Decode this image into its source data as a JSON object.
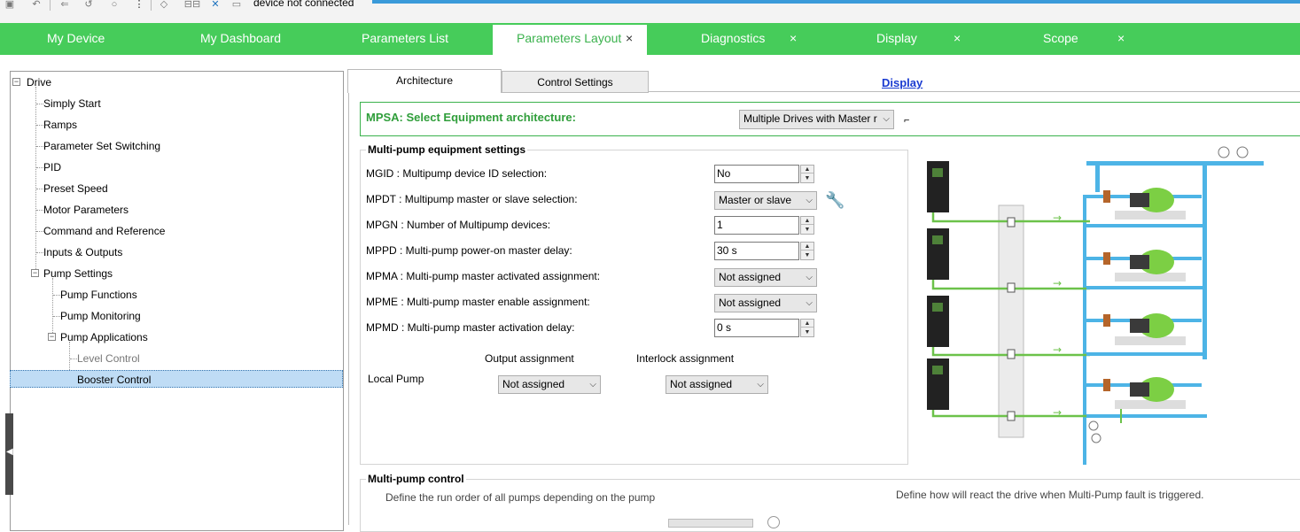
{
  "toolbar": {
    "connection_status": "device not connected",
    "icons": [
      "device-icon",
      "back-icon",
      "forward-icon",
      "undo-icon",
      "refresh-icon",
      "more-icon",
      "tag-icon",
      "network-icon",
      "disconnect-icon",
      "document-icon"
    ]
  },
  "tabs": [
    {
      "label": "My Device",
      "closable": false
    },
    {
      "label": "My Dashboard",
      "closable": false
    },
    {
      "label": "Parameters List",
      "closable": false
    },
    {
      "label": "Parameters Layout",
      "closable": true,
      "active": true
    },
    {
      "label": "Diagnostics",
      "closable": true
    },
    {
      "label": "Display",
      "closable": true
    },
    {
      "label": "Scope",
      "closable": true
    }
  ],
  "tree": {
    "root": "Drive",
    "items": [
      {
        "label": "Simply Start"
      },
      {
        "label": "Ramps"
      },
      {
        "label": "Parameter Set Switching"
      },
      {
        "label": "PID"
      },
      {
        "label": "Preset Speed"
      },
      {
        "label": "Motor Parameters"
      },
      {
        "label": "Command and Reference"
      },
      {
        "label": "Inputs & Outputs"
      },
      {
        "label": "Pump Settings"
      },
      {
        "label": "Pump Functions"
      },
      {
        "label": "Pump Monitoring"
      },
      {
        "label": "Pump Applications"
      },
      {
        "label": "Level Control"
      },
      {
        "label": "Booster Control"
      }
    ],
    "selected": "Booster Control"
  },
  "subtabs": {
    "architecture": "Architecture",
    "control_settings": "Control Settings",
    "display_link": "Display"
  },
  "mpsa": {
    "label": "MPSA: Select Equipment architecture:",
    "value": "Multiple Drives with Master r"
  },
  "multipump_settings": {
    "title": "Multi-pump equipment settings",
    "params": [
      {
        "label": "MGID : Multipump device ID selection:",
        "value": "No",
        "kind": "spin"
      },
      {
        "label": "MPDT : Multipump master or slave selection:",
        "value": "Master or slave",
        "kind": "combo"
      },
      {
        "label": "MPGN : Number of Multipump devices:",
        "value": "1",
        "kind": "spin"
      },
      {
        "label": "MPPD : Multi-pump power-on master delay:",
        "value": "30 s",
        "kind": "spin"
      },
      {
        "label": "MPMA : Multi-pump master activated assignment:",
        "value": "Not assigned",
        "kind": "combo"
      },
      {
        "label": "MPME : Multi-pump master enable assignment:",
        "value": "Not assigned",
        "kind": "combo"
      },
      {
        "label": "MPMD : Multi-pump master activation delay:",
        "value": "0 s",
        "kind": "spin"
      }
    ],
    "output_assignment_header": "Output assignment",
    "interlock_assignment_header": "Interlock assignment",
    "local_pump_label": "Local Pump",
    "local_pump_output": "Not assigned",
    "local_pump_interlock": "Not assigned"
  },
  "multipump_control": {
    "title": "Multi-pump control",
    "left_desc": "Define the run order of all pumps depending on the pump",
    "right_desc": "Define how will react the drive when Multi-Pump fault is triggered."
  },
  "colors": {
    "tab_green": "#46cc5a",
    "accent_green": "#2f9e3a",
    "link_blue": "#1a3bd1",
    "pipe_blue": "#4db4e6",
    "wire_green": "#6cc24a",
    "selection": "#bfdcf5"
  }
}
